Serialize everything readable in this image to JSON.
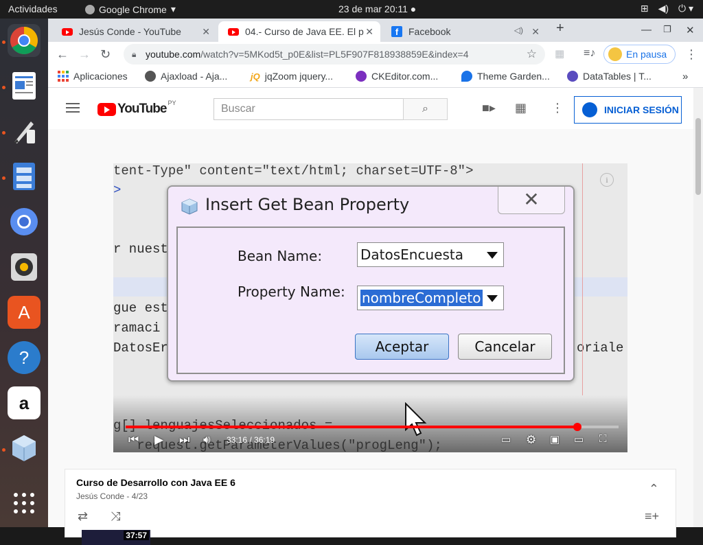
{
  "system": {
    "activities": "Actividades",
    "app_name": "Google Chrome",
    "clock": "23 de mar  20:11 ●"
  },
  "tabs": [
    {
      "title": "Jesús Conde - YouTube"
    },
    {
      "title": "04.- Curso de Java EE. El p"
    },
    {
      "title": "Facebook"
    }
  ],
  "address": {
    "host": "youtube.com",
    "path": "/watch?v=5MKod5t_p0E&list=PL5F907F818938859E&index=4"
  },
  "profile": {
    "label": "En pausa"
  },
  "bookmarks": [
    {
      "label": "Aplicaciones",
      "color": "#4285f4"
    },
    {
      "label": "Ajaxload - Aja...",
      "color": "#555555"
    },
    {
      "label": "jqZoom jquery...",
      "color": "#f2a516"
    },
    {
      "label": "CKEditor.com...",
      "color": "#7b2fbf"
    },
    {
      "label": "Theme Garden...",
      "color": "#1a73e8"
    },
    {
      "label": "DataTables | T...",
      "color": "#5a4cbf"
    }
  ],
  "youtube": {
    "logo_text": "YouTube",
    "country": "PY",
    "search_placeholder": "Buscar",
    "signin_label": "INICIAR SESIÓN"
  },
  "video": {
    "time": "33:16 / 36:19",
    "progress": 0.9164,
    "code_lines": [
      "tent-Type\" content=\"text/html; charset=UTF-8\">",
      ">",
      "r nuest",
      "gue est",
      "ramaci",
      "DatosEr",
      "oriale",
      "g[] lenguajesSeleccionados =",
      "   request.getParameterValues(\"progLeng\");"
    ]
  },
  "dialog": {
    "title": "Insert Get Bean Property",
    "close_glyph": "✕",
    "bean_label": "Bean Name:",
    "bean_value": "DatosEncuesta",
    "property_label": "Property Name:",
    "property_value": "nombreCompleto",
    "ok_label": "Aceptar",
    "cancel_label": "Cancelar"
  },
  "playlist": {
    "title": "Curso de Desarrollo con Java EE 6",
    "author": "Jesús Conde",
    "position": " - 4/23",
    "first_duration": "37:57"
  }
}
